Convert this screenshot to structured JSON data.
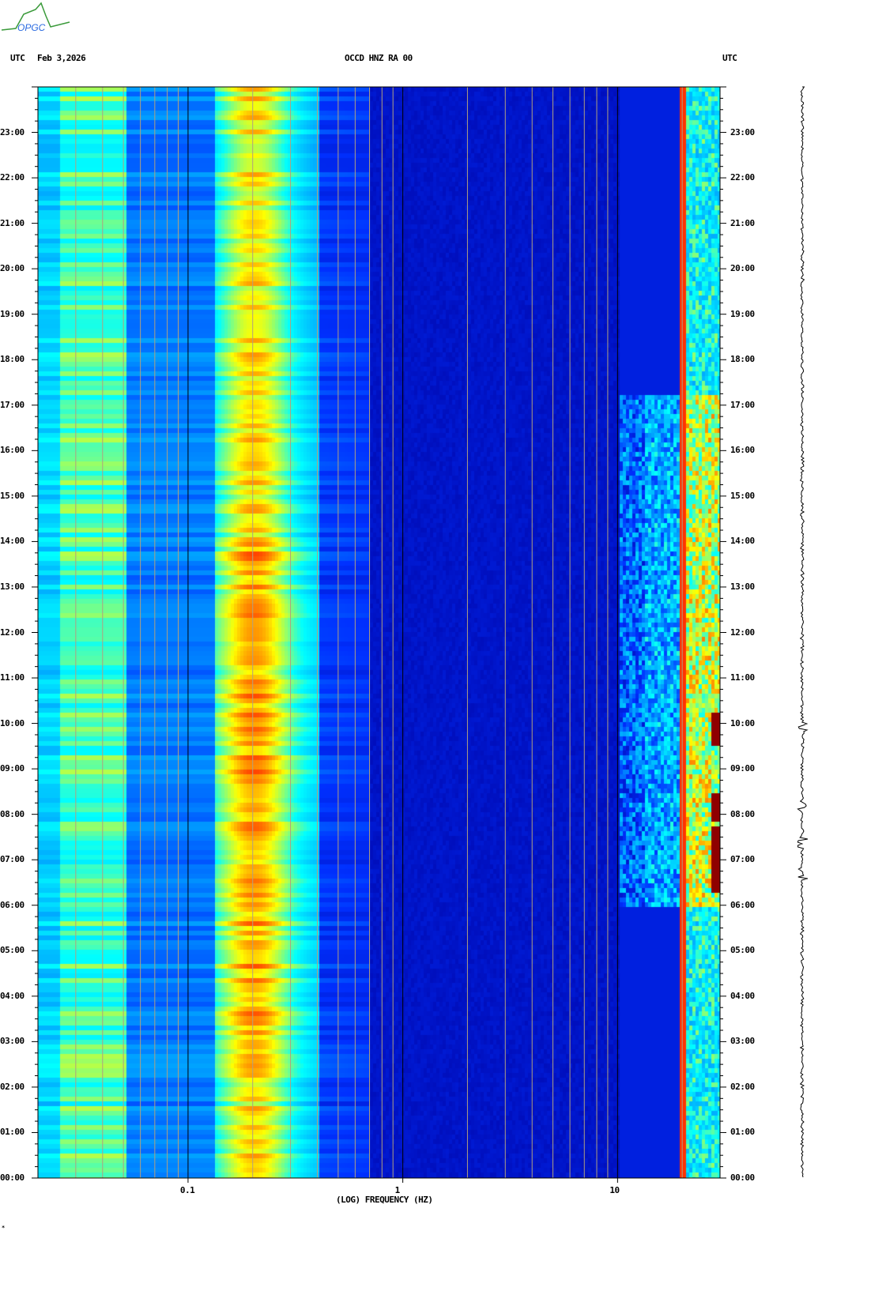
{
  "header": {
    "utc_left": "UTC",
    "date": "Feb 3,2026",
    "station": "OCCD HNZ RA 00",
    "utc_right": "UTC"
  },
  "logo_text": "OPGC",
  "footer_mark": "*",
  "chart_data": {
    "type": "heatmap",
    "title": "OCCD HNZ RA 00",
    "date": "Feb 3,2026",
    "xlabel": "(LOG) FREQUENCY (HZ)",
    "ylabel": "UTC",
    "xscale": "log",
    "xlim": [
      0.02,
      30
    ],
    "ylim_hours": [
      0,
      24
    ],
    "x_ticks": [
      {
        "value": 0.1,
        "label": "0.1"
      },
      {
        "value": 1,
        "label": "1"
      },
      {
        "value": 10,
        "label": "10"
      }
    ],
    "y_ticks": [
      {
        "h": 0,
        "label": "00:00"
      },
      {
        "h": 1,
        "label": "01:00"
      },
      {
        "h": 2,
        "label": "02:00"
      },
      {
        "h": 3,
        "label": "03:00"
      },
      {
        "h": 4,
        "label": "04:00"
      },
      {
        "h": 5,
        "label": "05:00"
      },
      {
        "h": 6,
        "label": "06:00"
      },
      {
        "h": 7,
        "label": "07:00"
      },
      {
        "h": 8,
        "label": "08:00"
      },
      {
        "h": 9,
        "label": "09:00"
      },
      {
        "h": 10,
        "label": "10:00"
      },
      {
        "h": 11,
        "label": "11:00"
      },
      {
        "h": 12,
        "label": "12:00"
      },
      {
        "h": 13,
        "label": "13:00"
      },
      {
        "h": 14,
        "label": "14:00"
      },
      {
        "h": 15,
        "label": "15:00"
      },
      {
        "h": 16,
        "label": "16:00"
      },
      {
        "h": 17,
        "label": "17:00"
      },
      {
        "h": 18,
        "label": "18:00"
      },
      {
        "h": 19,
        "label": "19:00"
      },
      {
        "h": 20,
        "label": "20:00"
      },
      {
        "h": 21,
        "label": "21:00"
      },
      {
        "h": 22,
        "label": "22:00"
      },
      {
        "h": 23,
        "label": "23:00"
      }
    ],
    "features": {
      "microseism_peak_hz": 0.2,
      "persistent_line_hz": 19.5,
      "daytime_activity_hours": [
        6,
        17
      ],
      "events_hours": [
        6.7,
        7.4,
        8.2,
        9.9
      ]
    },
    "colormap": [
      "#0000a0",
      "#0030ff",
      "#00a0ff",
      "#00ffff",
      "#ffff00",
      "#ff0000",
      "#800000"
    ]
  }
}
